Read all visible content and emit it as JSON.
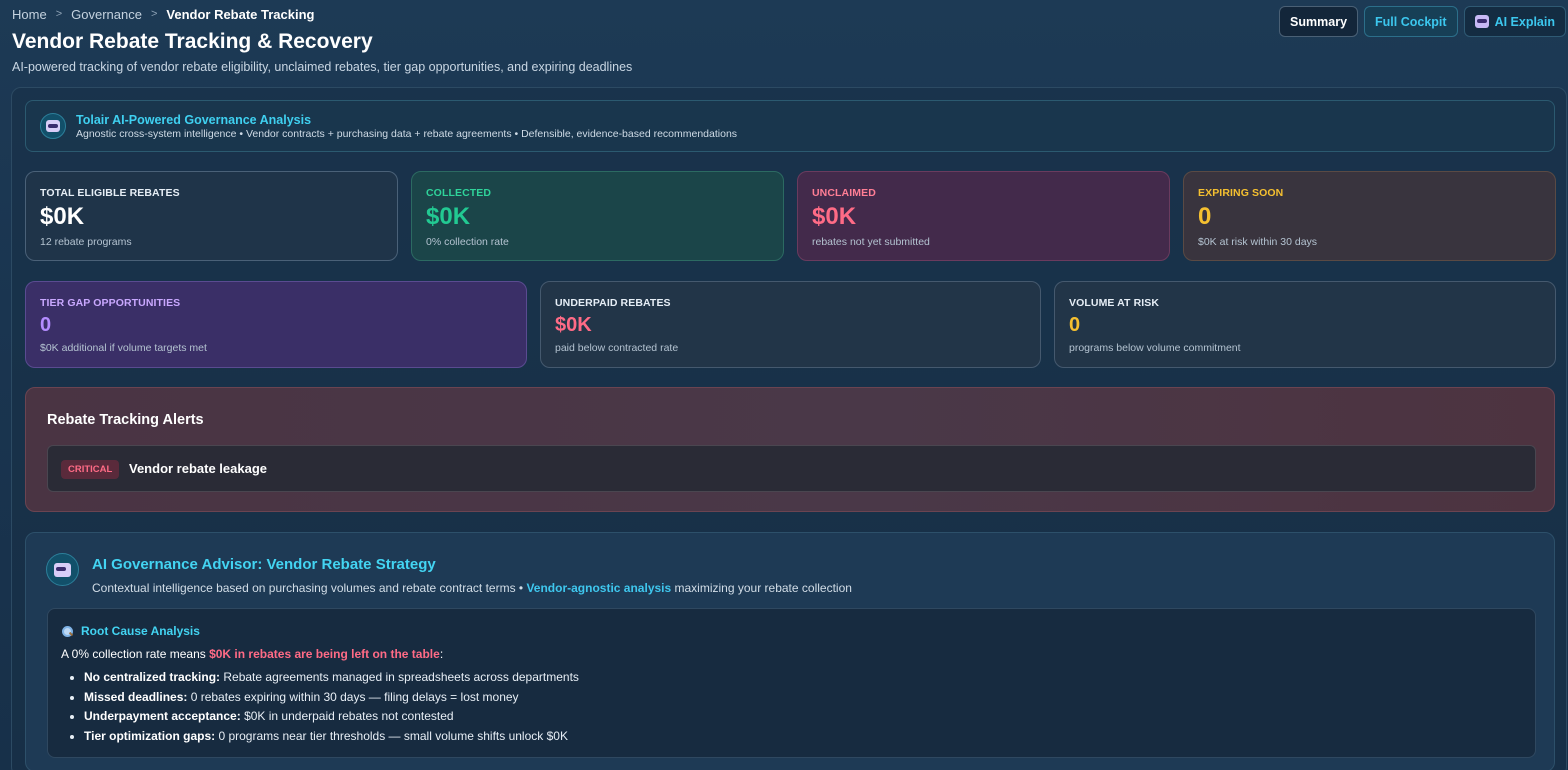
{
  "breadcrumb": {
    "home": "Home",
    "section": "Governance",
    "current": "Vendor Rebate Tracking",
    "separator": ">"
  },
  "header": {
    "title": "Vendor Rebate Tracking & Recovery",
    "subtitle": "AI-powered tracking of vendor rebate eligibility, unclaimed rebates, tier gap opportunities, and expiring deadlines"
  },
  "actions": {
    "summary": "Summary",
    "cockpit": "Full Cockpit",
    "ai_explain": "AI Explain"
  },
  "ai_banner": {
    "title": "Tolair AI-Powered Governance Analysis",
    "subtitle": "Agnostic cross-system intelligence • Vendor contracts + purchasing data + rebate agreements • Defensible, evidence-based recommendations"
  },
  "stats": {
    "eligible": {
      "label": "TOTAL ELIGIBLE REBATES",
      "value": "$0K",
      "sub": "12 rebate programs"
    },
    "collected": {
      "label": "COLLECTED",
      "value": "$0K",
      "sub": "0% collection rate"
    },
    "unclaimed": {
      "label": "UNCLAIMED",
      "value": "$0K",
      "sub": "rebates not yet submitted"
    },
    "expiring": {
      "label": "EXPIRING SOON",
      "value": "0",
      "sub": "$0K at risk within 30 days"
    },
    "tier": {
      "label": "TIER GAP OPPORTUNITIES",
      "value": "0",
      "sub": "$0K additional if volume targets met"
    },
    "underpaid": {
      "label": "UNDERPAID REBATES",
      "value": "$0K",
      "sub": "paid below contracted rate"
    },
    "volume": {
      "label": "VOLUME AT RISK",
      "value": "0",
      "sub": "programs below volume commitment"
    }
  },
  "colors": {
    "eligible": "#ffffff",
    "collected": "#22c992",
    "unclaimed": "#ff6b86",
    "expiring": "#f5c030",
    "tier": "#b48cff",
    "underpaid": "#ff6b86",
    "volume": "#f5c030",
    "label_eligible": "#e6eef6",
    "label_collected": "#2fd39a",
    "label_unclaimed": "#ff7e95",
    "label_expiring": "#f5c030",
    "label_tier": "#c9a8ff",
    "label_underpaid": "#e6eef6",
    "label_volume": "#e6eef6"
  },
  "alerts": {
    "title": "Rebate Tracking Alerts",
    "items": [
      {
        "severity": "CRITICAL",
        "text": "Vendor rebate leakage"
      }
    ]
  },
  "advisor": {
    "title": "AI Governance Advisor: Vendor Rebate Strategy",
    "sub_before": "Contextual intelligence based on purchasing volumes and rebate contract terms • ",
    "sub_highlight": "Vendor-agnostic analysis",
    "sub_after": " maximizing your rebate collection",
    "rca": {
      "icon": "magnifier-icon",
      "title": "Root Cause Analysis",
      "lead_before": "A 0% collection rate means ",
      "lead_highlight": "$0K in rebates are being left on the table",
      "lead_after": ":",
      "items": [
        {
          "term": "No centralized tracking:",
          "text": " Rebate agreements managed in spreadsheets across departments"
        },
        {
          "term": "Missed deadlines:",
          "text": " 0 rebates expiring within 30 days — filing delays = lost money"
        },
        {
          "term": "Underpayment acceptance:",
          "text": " $0K in underpaid rebates not contested"
        },
        {
          "term": "Tier optimization gaps:",
          "text": " 0 programs near tier thresholds — small volume shifts unlock $0K"
        }
      ]
    }
  }
}
